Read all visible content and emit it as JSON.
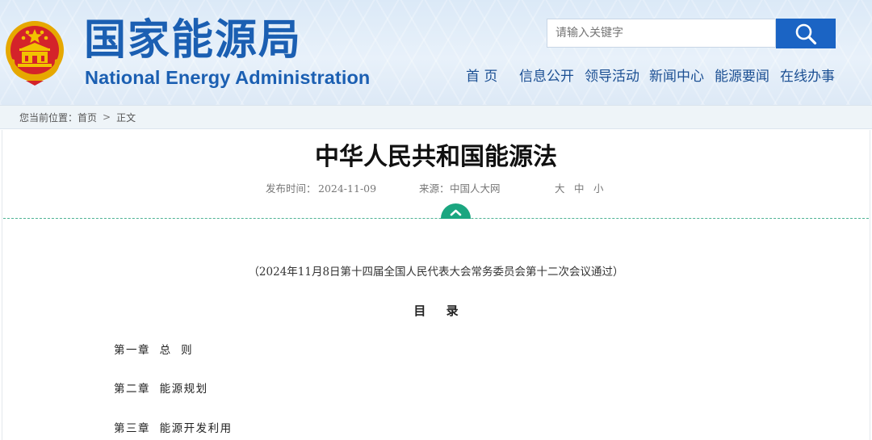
{
  "header": {
    "site_name_cn": "国家能源局",
    "site_name_en": "National Energy Administration",
    "emblem_icon": "national-emblem-icon",
    "search": {
      "placeholder": "请输入关键字",
      "button_icon": "search-icon"
    },
    "nav": [
      "首 页",
      "信息公开",
      "领导活动",
      "新闻中心",
      "能源要闻",
      "在线办事"
    ]
  },
  "breadcrumb": {
    "prefix": "您当前位置：",
    "items": [
      "首页",
      "正文"
    ],
    "separator": ">"
  },
  "article": {
    "title": "中华人民共和国能源法",
    "publish_label": "发布时间：",
    "publish_date": "2024-11-09",
    "source_label": "来源：",
    "source": "中国人大网",
    "font_sizes": [
      "大",
      "中",
      "小"
    ],
    "collapse_icon": "chevron-up-icon",
    "passage_note": "（2024年11月8日第十四届全国人民代表大会常务委员会第十二次会议通过）",
    "toc_title": "目 录",
    "toc": [
      "第一章  总  则",
      "第二章  能源规划",
      "第三章  能源开发利用"
    ]
  },
  "colors": {
    "brand_blue": "#1b5fb2",
    "search_button": "#1b64c4",
    "accent_green": "#1ba680",
    "emblem_red": "#d4232a",
    "emblem_gold": "#f2c200"
  }
}
